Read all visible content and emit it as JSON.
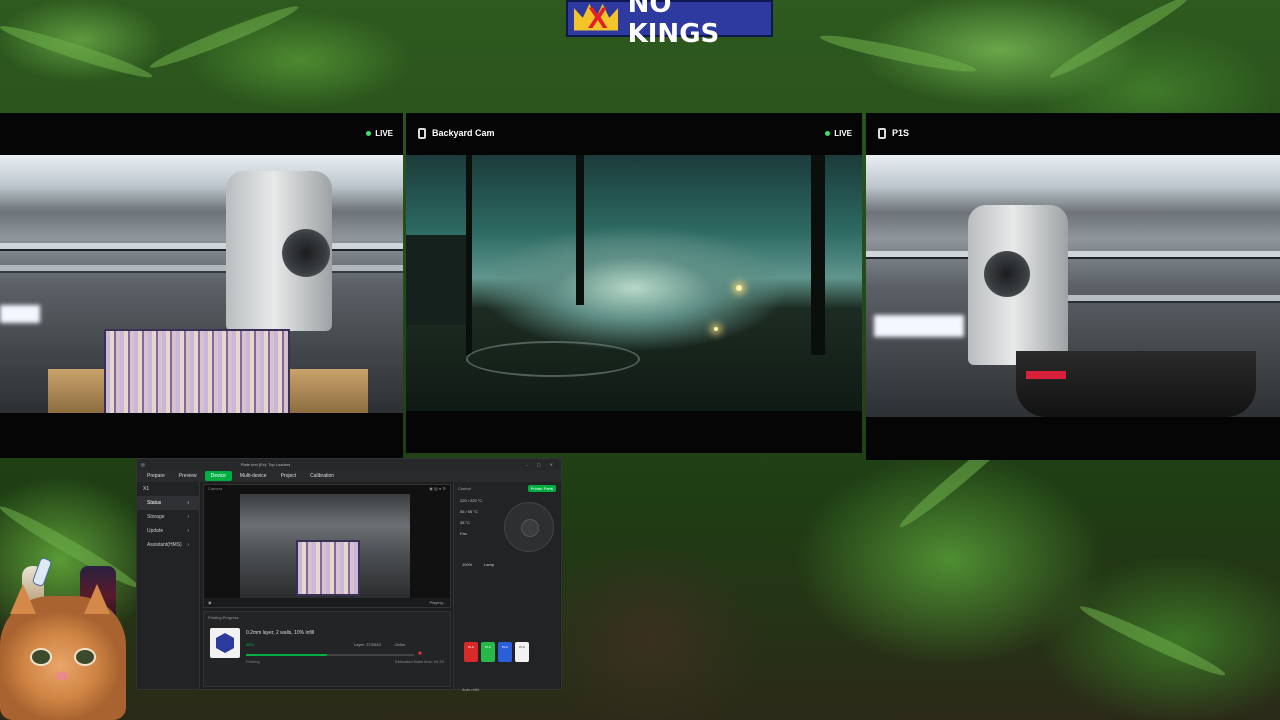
{
  "banner": {
    "text": "NO KINGS",
    "crown_mark": "X"
  },
  "cams": [
    {
      "name": "",
      "live": "LIVE",
      "status_color": "#3ee06a"
    },
    {
      "name": "Backyard Cam",
      "live": "LIVE"
    },
    {
      "name": "P1S",
      "live": ""
    }
  ],
  "studio": {
    "window_title": "Plate-text (Ex): Top Loaders",
    "tabs": [
      {
        "label": "Prepare"
      },
      {
        "label": "Preview"
      },
      {
        "label": "Device"
      },
      {
        "label": "Multi-device"
      },
      {
        "label": "Project"
      },
      {
        "label": "Calibration"
      }
    ],
    "device_name": "X1",
    "sidebar": [
      "Status",
      "Storage",
      "Update",
      "Assistant(HMS)"
    ],
    "camera_header": "Camera",
    "camera_status": "Playing...",
    "progress_header": "Printing Progress",
    "job_line": "0.2mm layer, 2 walls, 10% infill",
    "percent": "48%",
    "stage": "Printing",
    "layer": "Layer: 373/543",
    "time_left": "-2h0m",
    "finish": "Estimated finish time: 04:33",
    "progress_value": 0.48,
    "control_header": "Control",
    "parts_btn": "Printer Parts",
    "temps": [
      "220 / 220 °C",
      "55 / 55 °C",
      "38 °C"
    ],
    "fan_label": "Fan",
    "fan_value": "100%",
    "lamp_label": "Lamp",
    "spools": [
      {
        "label": "PLA",
        "color": "#d92a2a"
      },
      {
        "label": "PLA",
        "color": "#27b84a"
      },
      {
        "label": "PLA",
        "color": "#2a5fd9"
      },
      {
        "label": "PLA",
        "color": "#f2f2f2"
      }
    ],
    "rack_label": "Auto refill"
  }
}
